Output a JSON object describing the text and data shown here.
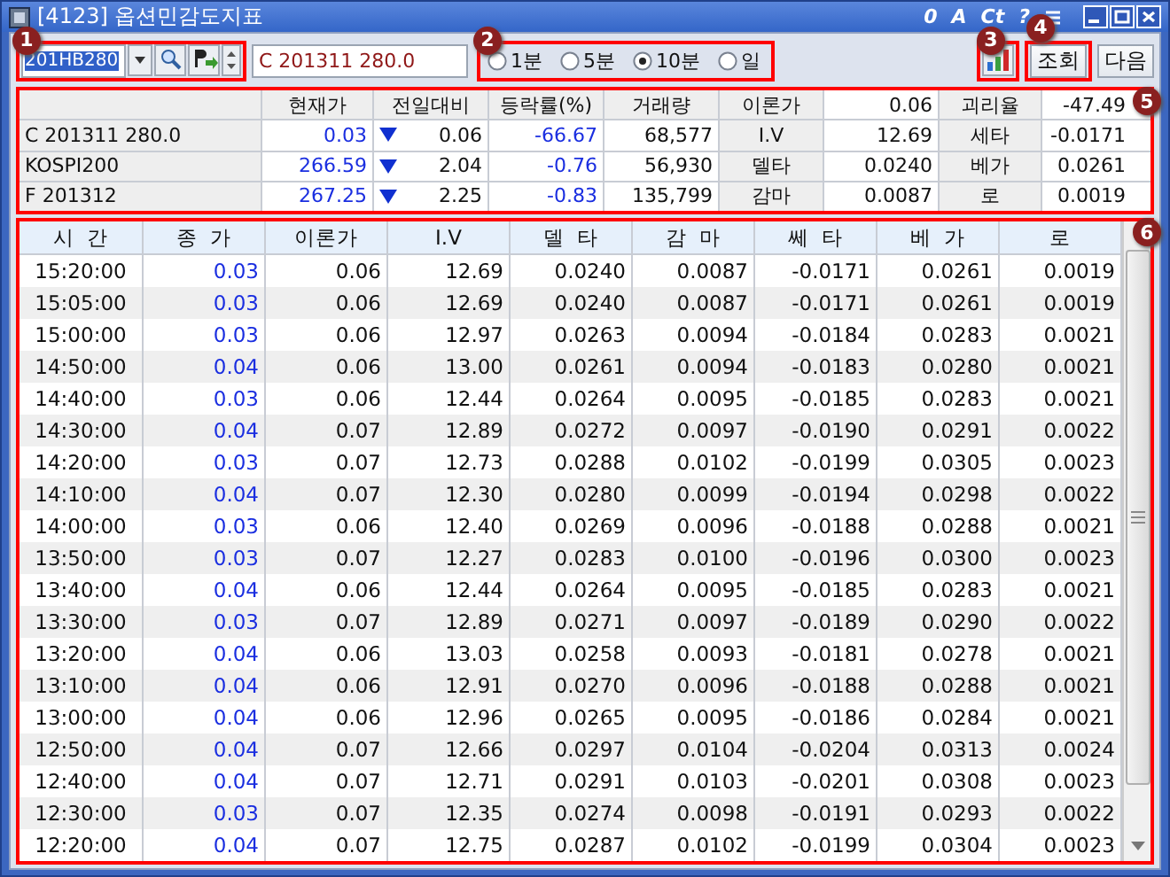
{
  "window": {
    "title": "[4123] 옵션민감도지표",
    "tools": [
      "0",
      "A",
      "Ct",
      "?"
    ]
  },
  "toolbar": {
    "callout": "1",
    "code": "201HB280",
    "name": "C 201311 280.0",
    "period": {
      "callout": "2",
      "options": [
        {
          "label": "1분",
          "selected": false
        },
        {
          "label": "5분",
          "selected": false
        },
        {
          "label": "10분",
          "selected": true
        },
        {
          "label": "일",
          "selected": false
        }
      ]
    },
    "chart_callout": "3",
    "query": {
      "label": "조회",
      "callout": "4"
    },
    "next": "다음"
  },
  "summary": {
    "callout": "5",
    "header": [
      "현재가",
      "전일대비",
      "등락률(%)",
      "거래량",
      "이론가",
      "0.06",
      "괴리율",
      "-47.49"
    ],
    "rows": [
      {
        "name": "C 201311 280.0",
        "price": "0.03",
        "down": true,
        "change": "0.06",
        "rate": "-66.67",
        "volume": "68,577",
        "label1": "I.V",
        "value1": "12.69",
        "label2": "세타",
        "value2": "-0.0171"
      },
      {
        "name": "KOSPI200",
        "price": "266.59",
        "down": true,
        "change": "2.04",
        "rate": "-0.76",
        "volume": "56,930",
        "label1": "델타",
        "value1": "0.0240",
        "label2": "베가",
        "value2": "0.0261"
      },
      {
        "name": "F 201312",
        "price": "267.25",
        "down": true,
        "change": "2.25",
        "rate": "-0.83",
        "volume": "135,799",
        "label1": "감마",
        "value1": "0.0087",
        "label2": "로",
        "value2": "0.0019"
      }
    ]
  },
  "table": {
    "callout": "6",
    "columns": [
      "시  간",
      "종  가",
      "이론가",
      "I.V",
      "델  타",
      "감  마",
      "쎄  타",
      "베  가",
      "로"
    ],
    "rows": [
      [
        "15:20:00",
        "0.03",
        "0.06",
        "12.69",
        "0.0240",
        "0.0087",
        "-0.0171",
        "0.0261",
        "0.0019"
      ],
      [
        "15:05:00",
        "0.03",
        "0.06",
        "12.69",
        "0.0240",
        "0.0087",
        "-0.0171",
        "0.0261",
        "0.0019"
      ],
      [
        "15:00:00",
        "0.03",
        "0.06",
        "12.97",
        "0.0263",
        "0.0094",
        "-0.0184",
        "0.0283",
        "0.0021"
      ],
      [
        "14:50:00",
        "0.04",
        "0.06",
        "13.00",
        "0.0261",
        "0.0094",
        "-0.0183",
        "0.0280",
        "0.0021"
      ],
      [
        "14:40:00",
        "0.03",
        "0.06",
        "12.44",
        "0.0264",
        "0.0095",
        "-0.0185",
        "0.0283",
        "0.0021"
      ],
      [
        "14:30:00",
        "0.04",
        "0.07",
        "12.89",
        "0.0272",
        "0.0097",
        "-0.0190",
        "0.0291",
        "0.0022"
      ],
      [
        "14:20:00",
        "0.03",
        "0.07",
        "12.73",
        "0.0288",
        "0.0102",
        "-0.0199",
        "0.0305",
        "0.0023"
      ],
      [
        "14:10:00",
        "0.04",
        "0.07",
        "12.30",
        "0.0280",
        "0.0099",
        "-0.0194",
        "0.0298",
        "0.0022"
      ],
      [
        "14:00:00",
        "0.03",
        "0.06",
        "12.40",
        "0.0269",
        "0.0096",
        "-0.0188",
        "0.0288",
        "0.0021"
      ],
      [
        "13:50:00",
        "0.03",
        "0.07",
        "12.27",
        "0.0283",
        "0.0100",
        "-0.0196",
        "0.0300",
        "0.0023"
      ],
      [
        "13:40:00",
        "0.04",
        "0.06",
        "12.44",
        "0.0264",
        "0.0095",
        "-0.0185",
        "0.0283",
        "0.0021"
      ],
      [
        "13:30:00",
        "0.03",
        "0.07",
        "12.89",
        "0.0271",
        "0.0097",
        "-0.0189",
        "0.0290",
        "0.0022"
      ],
      [
        "13:20:00",
        "0.04",
        "0.06",
        "13.03",
        "0.0258",
        "0.0093",
        "-0.0181",
        "0.0278",
        "0.0021"
      ],
      [
        "13:10:00",
        "0.04",
        "0.06",
        "12.91",
        "0.0270",
        "0.0096",
        "-0.0188",
        "0.0288",
        "0.0021"
      ],
      [
        "13:00:00",
        "0.04",
        "0.06",
        "12.96",
        "0.0265",
        "0.0095",
        "-0.0186",
        "0.0284",
        "0.0021"
      ],
      [
        "12:50:00",
        "0.04",
        "0.07",
        "12.66",
        "0.0297",
        "0.0104",
        "-0.0204",
        "0.0313",
        "0.0024"
      ],
      [
        "12:40:00",
        "0.04",
        "0.07",
        "12.71",
        "0.0291",
        "0.0103",
        "-0.0201",
        "0.0308",
        "0.0023"
      ],
      [
        "12:30:00",
        "0.03",
        "0.07",
        "12.35",
        "0.0274",
        "0.0098",
        "-0.0191",
        "0.0293",
        "0.0022"
      ],
      [
        "12:20:00",
        "0.04",
        "0.07",
        "12.75",
        "0.0287",
        "0.0102",
        "-0.0199",
        "0.0304",
        "0.0023"
      ]
    ]
  }
}
